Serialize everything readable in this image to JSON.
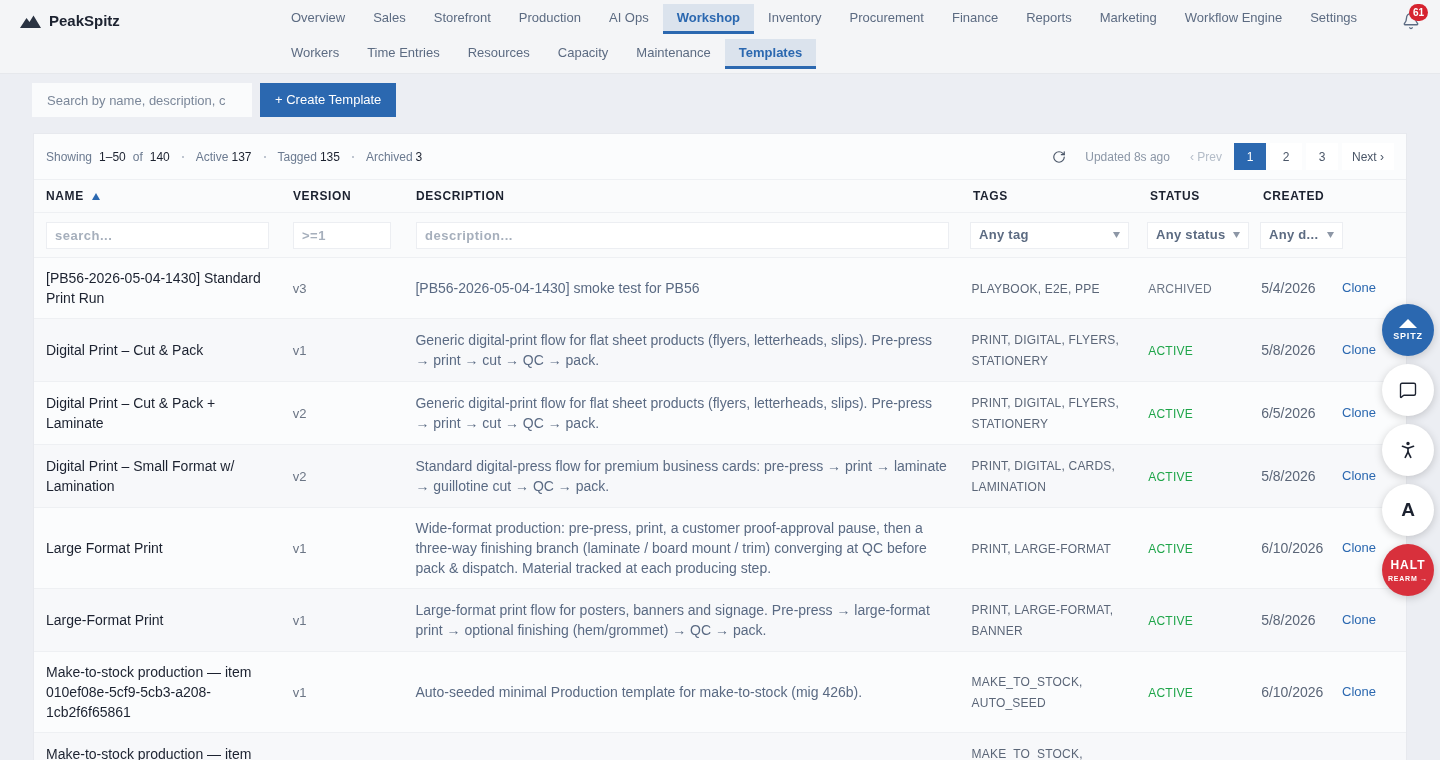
{
  "brand": {
    "name": "PeakSpitz"
  },
  "nav": {
    "primary": [
      {
        "label": "Overview",
        "selected": false
      },
      {
        "label": "Sales",
        "selected": false
      },
      {
        "label": "Storefront",
        "selected": false
      },
      {
        "label": "Production",
        "selected": false
      },
      {
        "label": "AI Ops",
        "selected": false
      },
      {
        "label": "Workshop",
        "selected": true
      },
      {
        "label": "Inventory",
        "selected": false
      },
      {
        "label": "Procurement",
        "selected": false
      },
      {
        "label": "Finance",
        "selected": false
      },
      {
        "label": "Reports",
        "selected": false
      },
      {
        "label": "Marketing",
        "selected": false
      },
      {
        "label": "Workflow Engine",
        "selected": false
      },
      {
        "label": "Settings",
        "selected": false
      }
    ],
    "secondary": [
      {
        "label": "Workers",
        "selected": false
      },
      {
        "label": "Time Entries",
        "selected": false
      },
      {
        "label": "Resources",
        "selected": false
      },
      {
        "label": "Capacity",
        "selected": false
      },
      {
        "label": "Maintenance",
        "selected": false
      },
      {
        "label": "Templates",
        "selected": true
      }
    ]
  },
  "notifications": {
    "count": "61"
  },
  "toolbar": {
    "search": {
      "placeholder": "Search by name, description, c"
    },
    "create_button": "+ Create Template"
  },
  "table": {
    "summary": {
      "showing_label": "Showing",
      "range": "1–50",
      "of_label": "of",
      "total": "140"
    },
    "stats": [
      {
        "label": "Active",
        "value": "137"
      },
      {
        "label": "Tagged",
        "value": "135"
      },
      {
        "label": "Archived",
        "value": "3"
      }
    ],
    "updated": "Updated 8s ago",
    "pagination": {
      "prev": {
        "label": "‹ Prev",
        "disabled": true
      },
      "pages": [
        {
          "label": "1",
          "selected": true
        },
        {
          "label": "2",
          "selected": false
        },
        {
          "label": "3",
          "selected": false
        }
      ],
      "next": {
        "label": "Next ›",
        "disabled": false
      }
    },
    "columns": [
      {
        "label": "NAME",
        "sorted": true
      },
      {
        "label": "VERSION",
        "sorted": false
      },
      {
        "label": "DESCRIPTION",
        "sorted": false
      },
      {
        "label": "TAGS",
        "sorted": false
      },
      {
        "label": "STATUS",
        "sorted": false
      },
      {
        "label": "CREATED",
        "sorted": false
      }
    ],
    "filters": [
      {
        "kind": "input",
        "placeholder": "search..."
      },
      {
        "kind": "input",
        "placeholder": ">=1"
      },
      {
        "kind": "input",
        "placeholder": "description..."
      },
      {
        "kind": "select",
        "value": "Any tag"
      },
      {
        "kind": "select",
        "value": "Any status"
      },
      {
        "kind": "select",
        "value": "Any d..."
      }
    ],
    "rows": [
      {
        "name": "[PB56-2026-05-04-1430] Standard Print Run",
        "version": "v3",
        "description": "[PB56-2026-05-04-1430] smoke test for PB56",
        "tags": "PLAYBOOK, E2E, PPE",
        "status": {
          "label": "ARCHIVED",
          "kind": "archived"
        },
        "created": "5/4/2026",
        "action": "Clone"
      },
      {
        "name": "Digital Print – Cut & Pack",
        "version": "v1",
        "description": "Generic digital-print flow for flat sheet products (flyers, letterheads, slips). Pre-press → print → cut → QC → pack.",
        "tags": "PRINT, DIGITAL, FLYERS, STATIONERY",
        "status": {
          "label": "ACTIVE",
          "kind": "active"
        },
        "created": "5/8/2026",
        "action": "Clone"
      },
      {
        "name": "Digital Print – Cut & Pack + Laminate",
        "version": "v2",
        "description": "Generic digital-print flow for flat sheet products (flyers, letterheads, slips). Pre-press → print → cut → QC → pack.",
        "tags": "PRINT, DIGITAL, FLYERS, STATIONERY",
        "status": {
          "label": "ACTIVE",
          "kind": "active"
        },
        "created": "6/5/2026",
        "action": "Clone"
      },
      {
        "name": "Digital Print – Small Format w/ Lamination",
        "version": "v2",
        "description": "Standard digital-press flow for premium business cards: pre-press → print → laminate → guillotine cut → QC → pack.",
        "tags": "PRINT, DIGITAL, CARDS, LAMINATION",
        "status": {
          "label": "ACTIVE",
          "kind": "active"
        },
        "created": "5/8/2026",
        "action": "Clone"
      },
      {
        "name": "Large Format Print",
        "version": "v1",
        "description": "Wide-format production: pre-press, print, a customer proof-approval pause, then a three-way finishing branch (laminate / board mount / trim) converging at QC before pack & dispatch. Material tracked at each producing step.",
        "tags": "PRINT, LARGE-FORMAT",
        "status": {
          "label": "ACTIVE",
          "kind": "active"
        },
        "created": "6/10/2026",
        "action": "Clone"
      },
      {
        "name": "Large-Format Print",
        "version": "v1",
        "description": "Large-format print flow for posters, banners and signage. Pre-press → large-format print → optional finishing (hem/grommet) → QC → pack.",
        "tags": "PRINT, LARGE-FORMAT, BANNER",
        "status": {
          "label": "ACTIVE",
          "kind": "active"
        },
        "created": "5/8/2026",
        "action": "Clone"
      },
      {
        "name": "Make-to-stock production — item 010ef08e-5cf9-5cb3-a208-1cb2f6f65861",
        "version": "v1",
        "description": "Auto-seeded minimal Production template for make-to-stock (mig 426b).",
        "tags": "MAKE_TO_STOCK, AUTO_SEED",
        "status": {
          "label": "ACTIVE",
          "kind": "active"
        },
        "created": "6/10/2026",
        "action": "Clone"
      },
      {
        "name": "Make-to-stock production — item",
        "tags": "MAKE_TO_STOCK,"
      }
    ]
  },
  "floating_actions": [
    {
      "kind": "brand",
      "label": "SPITZ"
    },
    {
      "kind": "chat"
    },
    {
      "kind": "accessibility"
    },
    {
      "kind": "text",
      "label": "A"
    },
    {
      "kind": "halt",
      "label": "HALT",
      "sublabel": "REARM →"
    }
  ]
}
